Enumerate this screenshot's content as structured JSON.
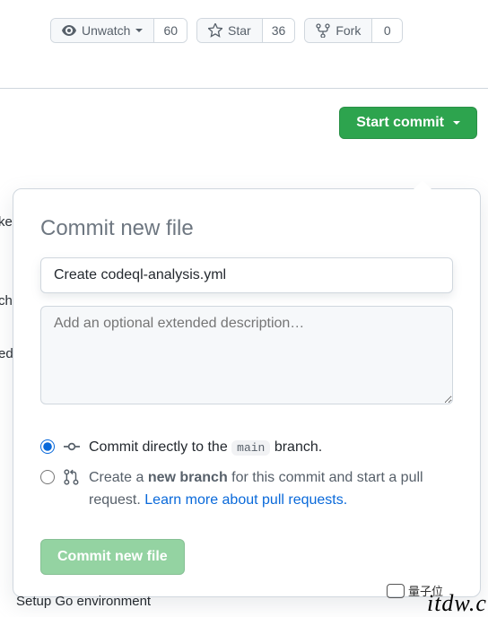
{
  "header": {
    "watch": {
      "label": "Unwatch",
      "count": "60"
    },
    "star": {
      "label": "Star",
      "count": "36"
    },
    "fork": {
      "label": "Fork",
      "count": "0"
    }
  },
  "startCommit": {
    "label": "Start commit"
  },
  "popover": {
    "title": "Commit new file",
    "messageValue": "Create codeql-analysis.yml",
    "descPlaceholder": "Add an optional extended description…",
    "radioDirectPrefix": "Commit directly to the ",
    "radioDirectBranch": "main",
    "radioDirectSuffix": " branch.",
    "radioNewPrefix": "Create a ",
    "radioNewBold": "new branch",
    "radioNewSuffix": " for this commit and start a pull request. ",
    "radioNewLink": "Learn more about pull requests.",
    "commitBtn": "Commit new file"
  },
  "behind": {
    "t1": "ke",
    "t2": "ch",
    "t3": "ed",
    "bottom": "Setup Go environment"
  },
  "watermark": {
    "logoText": "量子位",
    "url": "itdw.cr"
  }
}
